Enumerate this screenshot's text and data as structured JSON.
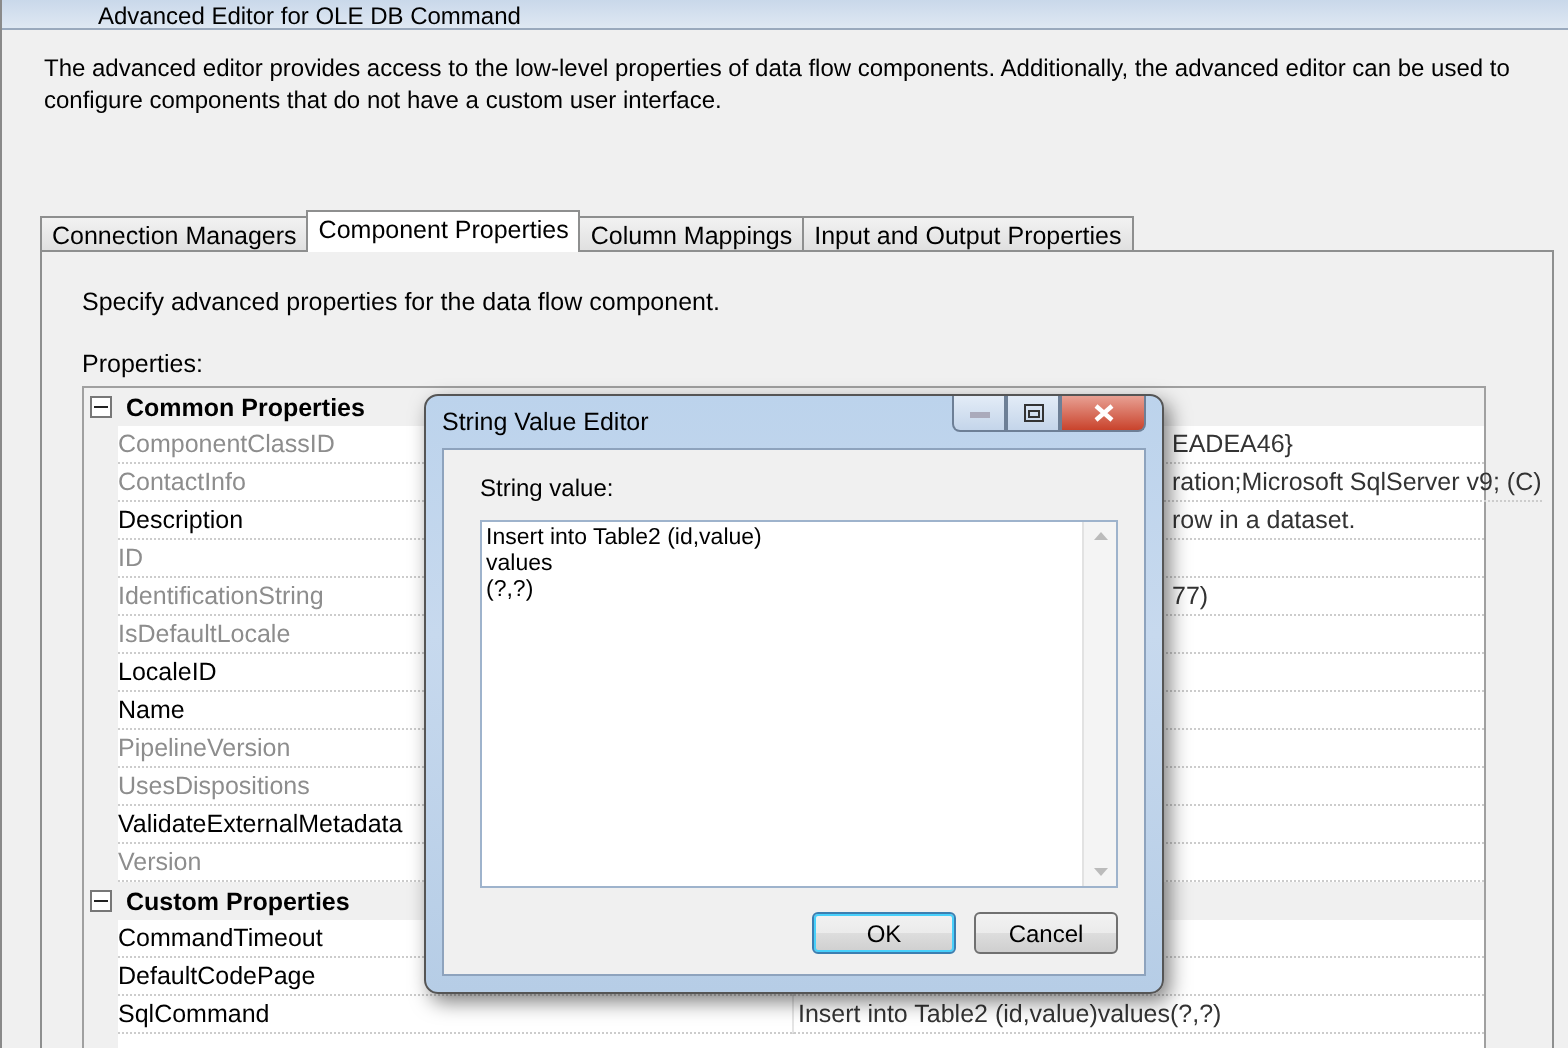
{
  "window": {
    "title": "Advanced Editor for OLE DB Command"
  },
  "intro": "The advanced editor provides access to the low-level properties of data flow components. Additionally, the advanced editor can be used to configure components that do not have a custom user interface.",
  "tabs": [
    {
      "label": "Connection Managers",
      "selected": false
    },
    {
      "label": "Component Properties",
      "selected": true
    },
    {
      "label": "Column Mappings",
      "selected": false
    },
    {
      "label": "Input and Output Properties",
      "selected": false
    }
  ],
  "panel": {
    "hint": "Specify advanced properties for the data flow component.",
    "properties_label": "Properties:"
  },
  "property_grid": [
    {
      "category": "Common Properties",
      "expanded": true,
      "rows": [
        {
          "name": "ComponentClassID",
          "disabled": true,
          "value": "EADEA46}",
          "behind_dialog": true
        },
        {
          "name": "ContactInfo",
          "disabled": true,
          "value": "ration;Microsoft SqlServer v9; (C)",
          "behind_dialog": true
        },
        {
          "name": "Description",
          "disabled": false,
          "value": "row in a dataset.",
          "behind_dialog": true
        },
        {
          "name": "ID",
          "disabled": true
        },
        {
          "name": "IdentificationString",
          "disabled": true,
          "value": "77)",
          "behind_dialog": true
        },
        {
          "name": "IsDefaultLocale",
          "disabled": true
        },
        {
          "name": "LocaleID",
          "disabled": false
        },
        {
          "name": "Name",
          "disabled": false
        },
        {
          "name": "PipelineVersion",
          "disabled": true
        },
        {
          "name": "UsesDispositions",
          "disabled": true
        },
        {
          "name": "ValidateExternalMetadata",
          "disabled": false
        },
        {
          "name": "Version",
          "disabled": true
        }
      ]
    },
    {
      "category": "Custom Properties",
      "expanded": true,
      "rows": [
        {
          "name": "CommandTimeout",
          "disabled": false
        },
        {
          "name": "DefaultCodePage",
          "disabled": false
        },
        {
          "name": "SqlCommand",
          "disabled": false,
          "value": "Insert into Table2 (id,value)values(?,?)",
          "behind_dialog": false
        }
      ]
    }
  ],
  "dialog": {
    "title": "String Value Editor",
    "label": "String value:",
    "value_lines": [
      "Insert into Table2 (id,value)",
      "values",
      "(?,?)"
    ],
    "buttons": [
      {
        "label": "OK",
        "focused": true
      },
      {
        "label": "Cancel",
        "focused": false
      }
    ]
  }
}
